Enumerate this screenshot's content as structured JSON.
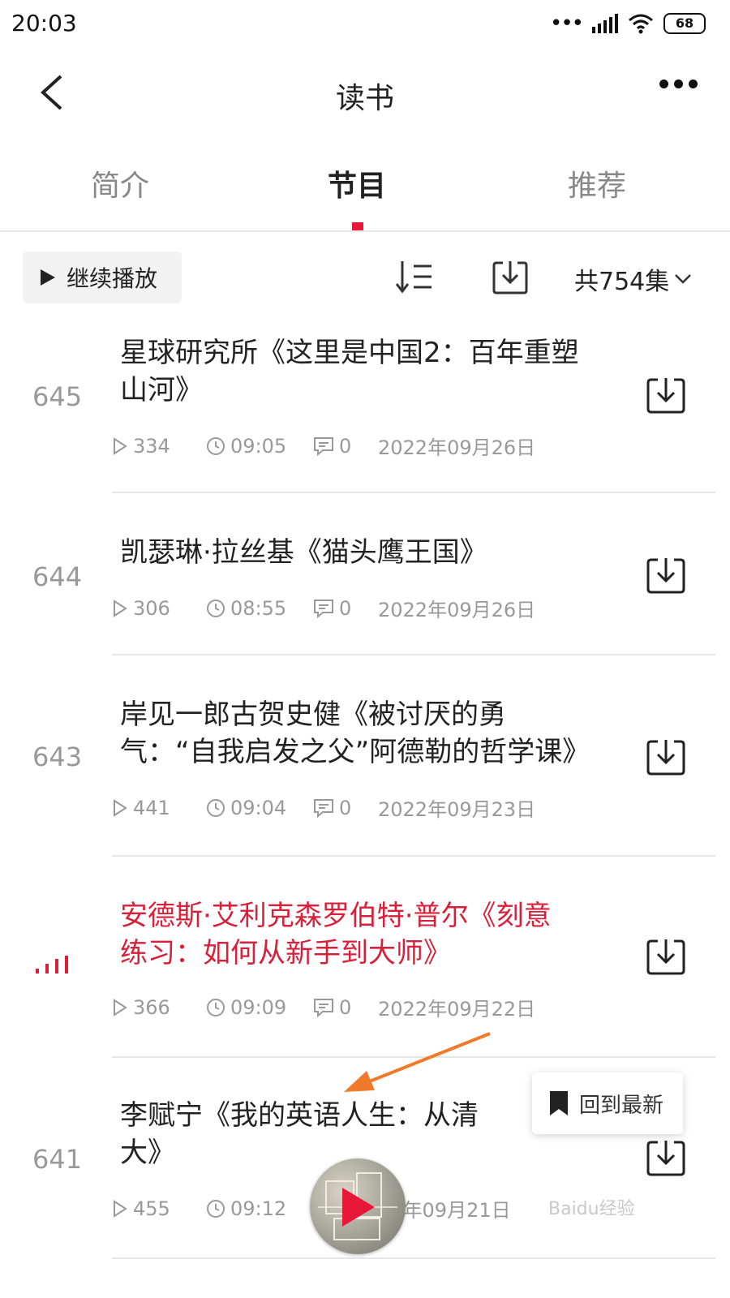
{
  "status_bar": {
    "time": "20:03",
    "battery": "68"
  },
  "nav": {
    "title": "读书"
  },
  "tabs": [
    {
      "label": "简介"
    },
    {
      "label": "节目"
    },
    {
      "label": "推荐"
    }
  ],
  "toolbar": {
    "continue_label": "继续播放",
    "count_label": "共754集"
  },
  "episodes": [
    {
      "number": "645",
      "title_line1": "星球研究所《这里是中国2：百年重塑",
      "title_line2": "山河》",
      "plays": "334",
      "duration": "09:05",
      "comments": "0",
      "date": "2022年09月26日"
    },
    {
      "number": "644",
      "title_line1": "凯瑟琳·拉丝基《猫头鹰王国》",
      "title_line2": "",
      "plays": "306",
      "duration": "08:55",
      "comments": "0",
      "date": "2022年09月26日"
    },
    {
      "number": "643",
      "title_line1": "岸见一郎古贺史健《被讨厌的勇",
      "title_line2": "气：“自我启发之父”阿德勒的哲学课》",
      "plays": "441",
      "duration": "09:04",
      "comments": "0",
      "date": "2022年09月23日"
    },
    {
      "number": "",
      "title_line1": "安德斯·艾利克森罗伯特·普尔《刻意",
      "title_line2": "练习：如何从新手到大师》",
      "plays": "366",
      "duration": "09:09",
      "comments": "0",
      "date": "2022年09月22日",
      "playing": true
    },
    {
      "number": "641",
      "title_line1": "李赋宁《我的英语人生：从清",
      "title_line2": "大》",
      "plays": "455",
      "duration": "09:12",
      "comments": "",
      "date": "22年09月21日"
    }
  ],
  "back_to_latest": {
    "label": "回到最新"
  },
  "watermark": {
    "text": "Baidu经验"
  },
  "colors": {
    "accent": "#e8173a",
    "annotation_arrow": "#f07a2a"
  }
}
